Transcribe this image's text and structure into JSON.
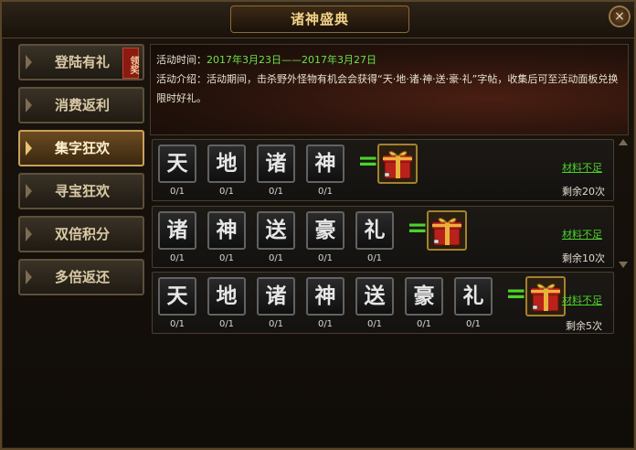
{
  "window": {
    "title": "诸神盛典",
    "close_label": "×"
  },
  "sidebar": {
    "items": [
      {
        "label": "登陆有礼",
        "badge": "领奖",
        "active": false
      },
      {
        "label": "消费返利",
        "active": false
      },
      {
        "label": "集字狂欢",
        "active": true
      },
      {
        "label": "寻宝狂欢",
        "active": false
      },
      {
        "label": "双倍积分",
        "active": false
      },
      {
        "label": "多倍返还",
        "active": false
      }
    ]
  },
  "info": {
    "time_label": "活动时间：",
    "time_value": "2017年3月23日——2017年3月27日",
    "intro_label": "活动介绍：",
    "intro_text": "活动期间，击杀野外怪物有机会会获得“天·地·诸·神·送·豪·礼”字帖，收集后可至活动面板兑换限时好礼。"
  },
  "rows": [
    {
      "chars": [
        "天",
        "地",
        "诸",
        "神"
      ],
      "counts": [
        "0/1",
        "0/1",
        "0/1",
        "0/1"
      ],
      "equals": "=",
      "reward_icon": "gift-box-icon",
      "action": "材料不足",
      "remaining": "剩余20次"
    },
    {
      "chars": [
        "诸",
        "神",
        "送",
        "豪",
        "礼"
      ],
      "counts": [
        "0/1",
        "0/1",
        "0/1",
        "0/1",
        "0/1"
      ],
      "equals": "=",
      "reward_icon": "gift-box-icon",
      "action": "材料不足",
      "remaining": "剩余10次"
    },
    {
      "chars": [
        "天",
        "地",
        "诸",
        "神",
        "送",
        "豪",
        "礼"
      ],
      "counts": [
        "0/1",
        "0/1",
        "0/1",
        "0/1",
        "0/1",
        "0/1",
        "0/1"
      ],
      "equals": "=",
      "reward_icon": "gift-box-icon",
      "action": "材料不足",
      "remaining": "剩余5次"
    }
  ],
  "colors": {
    "accent_green": "#4ed12e",
    "title_gold": "#f2d28a",
    "active_tab": "#6b4a21"
  }
}
